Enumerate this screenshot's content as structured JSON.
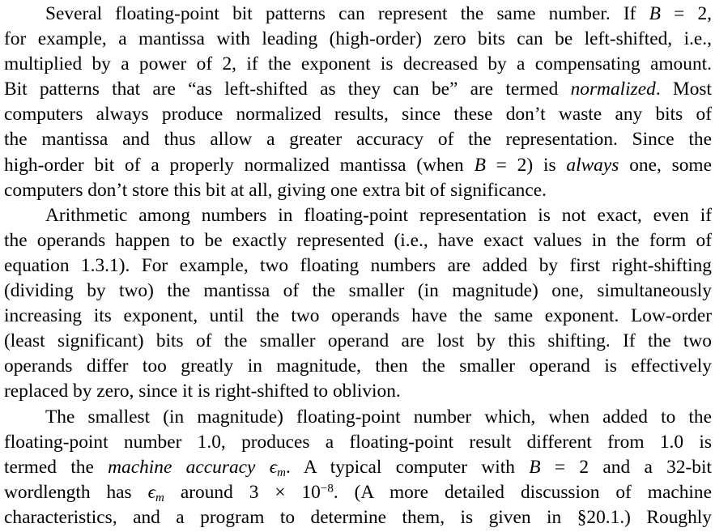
{
  "paragraphs": [
    {
      "lines": [
        [
          {
            "t": "Several floating-point bit patterns can represent the same number. If "
          },
          {
            "t": "B",
            "s": "i"
          },
          {
            "t": " = 2,"
          }
        ],
        [
          {
            "t": "for example, a mantissa with leading (high-order) zero bits can be left-shifted, i.e.,"
          }
        ],
        [
          {
            "t": "multiplied by a power of 2, if the exponent is decreased by a compensating amount."
          }
        ],
        [
          {
            "t": "Bit patterns that are “as left-shifted as they can be” are termed "
          },
          {
            "t": "normalized",
            "s": "i"
          },
          {
            "t": ". Most"
          }
        ],
        [
          {
            "t": "computers always produce normalized results, since these don’t waste any bits of"
          }
        ],
        [
          {
            "t": "the mantissa and thus allow a greater accuracy of the representation. Since the"
          }
        ],
        [
          {
            "t": "high-order bit of a properly normalized mantissa (when "
          },
          {
            "t": "B",
            "s": "i"
          },
          {
            "t": " = 2) is "
          },
          {
            "t": "always",
            "s": "i"
          },
          {
            "t": " one, some"
          }
        ],
        [
          {
            "t": "computers don’t store this bit at all, giving one extra bit of significance."
          }
        ]
      ]
    },
    {
      "lines": [
        [
          {
            "t": "Arithmetic among numbers in floating-point representation is not exact, even if"
          }
        ],
        [
          {
            "t": "the operands happen to be exactly represented (i.e., have exact values in the form of"
          }
        ],
        [
          {
            "t": "equation 1.3.1). For example, two floating numbers are added by first right-shifting"
          }
        ],
        [
          {
            "t": "(dividing by two) the mantissa of the smaller (in magnitude) one, simultaneously"
          }
        ],
        [
          {
            "t": "increasing its exponent, until the two operands have the same exponent. Low-order"
          }
        ],
        [
          {
            "t": "(least significant) bits of the smaller operand are lost by this shifting. If the two"
          }
        ],
        [
          {
            "t": "operands differ too greatly in magnitude, then the smaller operand is effectively"
          }
        ],
        [
          {
            "t": "replaced by zero, since it is right-shifted to oblivion."
          }
        ]
      ]
    },
    {
      "lines": [
        [
          {
            "t": "The smallest (in magnitude) floating-point number which, when added to the"
          }
        ],
        [
          {
            "t": "floating-point number 1.0, produces a floating-point result different from 1.0 is"
          }
        ],
        [
          {
            "t": "termed the "
          },
          {
            "t": "machine accuracy",
            "s": "i"
          },
          {
            "t": " "
          },
          {
            "t": "ϵ",
            "s": "i"
          },
          {
            "t": "m",
            "s": "sub-i"
          },
          {
            "t": ". A typical computer with "
          },
          {
            "t": "B",
            "s": "i"
          },
          {
            "t": " = 2 and a 32-bit"
          }
        ],
        [
          {
            "t": "wordlength has "
          },
          {
            "t": "ϵ",
            "s": "i"
          },
          {
            "t": "m",
            "s": "sub-i"
          },
          {
            "t": " around 3 × 10"
          },
          {
            "t": "−8",
            "s": "sup"
          },
          {
            "t": ". (A more detailed discussion of machine"
          }
        ],
        [
          {
            "t": "characteristics, and a program to determine them, is given in §20.1.) Roughly"
          }
        ]
      ]
    }
  ]
}
